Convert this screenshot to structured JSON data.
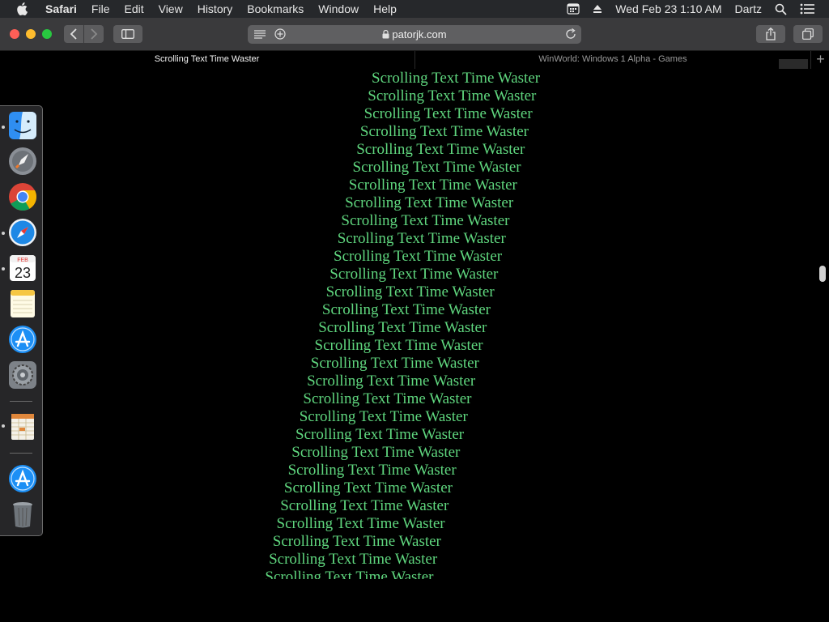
{
  "menubar": {
    "app_name": "Safari",
    "items": [
      "File",
      "Edit",
      "View",
      "History",
      "Bookmarks",
      "Window",
      "Help"
    ],
    "datetime": "Wed Feb 23  1:10 AM",
    "user": "Dartz"
  },
  "toolbar": {
    "url": "patorjk.com"
  },
  "tabs": [
    {
      "title": "Scrolling Text Time Waster",
      "active": true
    },
    {
      "title": "WinWorld: Windows 1 Alpha - Games",
      "active": false
    }
  ],
  "page": {
    "line_text": "Scrolling Text Time Waster",
    "line_count": 29,
    "text_color": "#5fd67e",
    "background": "#000000"
  },
  "dock": {
    "apps": [
      "finder-icon",
      "launchpad-icon",
      "chrome-icon",
      "safari-icon",
      "calendar-icon",
      "notes-icon",
      "app-store-icon",
      "system-preferences-icon",
      "numbers-icon",
      "app-store-downloads-icon",
      "trash-icon"
    ],
    "calendar_month": "FEB",
    "calendar_day": "23"
  }
}
